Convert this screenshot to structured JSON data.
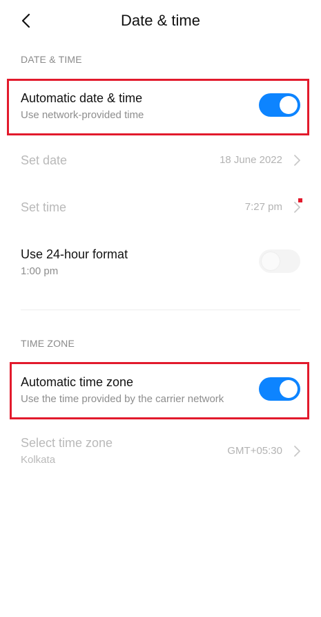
{
  "header": {
    "title": "Date & time",
    "back_icon": "chevron-left-icon"
  },
  "sections": {
    "date_time": "DATE & TIME",
    "time_zone": "TIME ZONE"
  },
  "rows": {
    "auto_date_time": {
      "title": "Automatic date & time",
      "subtitle": "Use network-provided time",
      "enabled": true
    },
    "set_date": {
      "title": "Set date",
      "value": "18 June 2022"
    },
    "set_time": {
      "title": "Set time",
      "value": "7:27 pm"
    },
    "hour24": {
      "title": "Use 24-hour format",
      "subtitle": "1:00 pm",
      "enabled": false
    },
    "auto_time_zone": {
      "title": "Automatic time zone",
      "subtitle": "Use the time provided by the carrier network",
      "enabled": true
    },
    "select_time_zone": {
      "title": "Select time zone",
      "subtitle": "Kolkata",
      "value": "GMT+05:30"
    }
  },
  "colors": {
    "accent": "#0d84ff",
    "highlight": "#e21a2c",
    "disabled_text": "#b9b9b9"
  }
}
